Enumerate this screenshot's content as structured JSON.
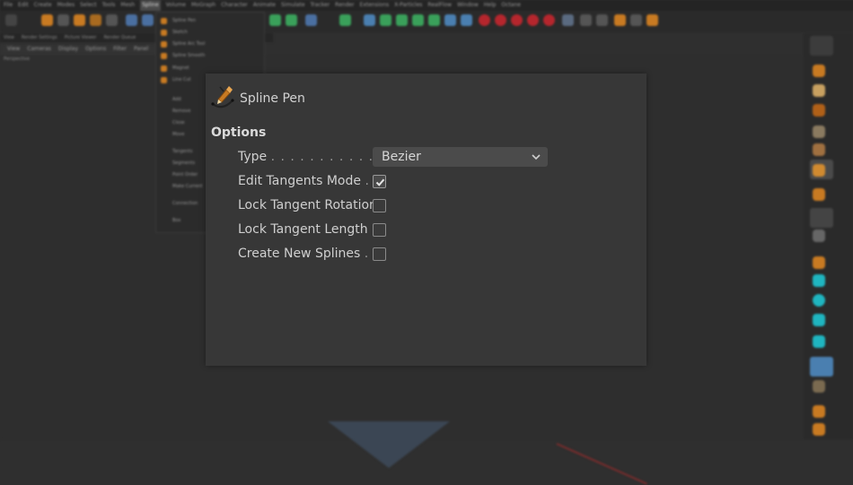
{
  "app": {
    "menu": [
      "File",
      "Edit",
      "Create",
      "Modes",
      "Select",
      "Tools",
      "Mesh",
      "Spline",
      "Volume",
      "MoGraph",
      "Character",
      "Animate",
      "Simulate",
      "Tracker",
      "Render",
      "Extensions",
      "X-Particles",
      "RealFlow",
      "Window",
      "Help",
      "Octane"
    ],
    "active_menu_index": 7,
    "tabs": [
      "View",
      "Render Settings",
      "Picture Viewer",
      "Render Queue"
    ],
    "view_menu": [
      "View",
      "Cameras",
      "Display",
      "Options",
      "Filter",
      "Panel"
    ],
    "viewport_label": "Perspective",
    "spline_menu": [
      "Spline Pen",
      "Sketch",
      "Spline Arc Tool",
      "Spline Smooth",
      "Magnet",
      "Line Cut",
      "Add",
      "Remove",
      "Close",
      "Move",
      "Tangents",
      "Segments",
      "Point Order",
      "Make Current",
      "Connection",
      "Box"
    ]
  },
  "dialog": {
    "title": "Spline Pen",
    "section": "Options",
    "type_label": "Type",
    "type_dots": ". . . . . . . . . . . . .",
    "type_value": "Bezier",
    "checkboxes": [
      {
        "label": "Edit Tangents Mode",
        "dots": ". .",
        "checked": true
      },
      {
        "label": "Lock Tangent Rotation",
        "dots": "",
        "checked": false
      },
      {
        "label": "Lock Tangent Length",
        "dots": "",
        "checked": false
      },
      {
        "label": "Create New Splines",
        "dots": ". .",
        "checked": false
      }
    ]
  },
  "colors": {
    "accent_orange": "#c87a22",
    "accent_red": "#b5262d",
    "accent_green": "#3aa05a",
    "accent_teal": "#1fb5c0",
    "accent_blue": "#4a7fb0"
  }
}
